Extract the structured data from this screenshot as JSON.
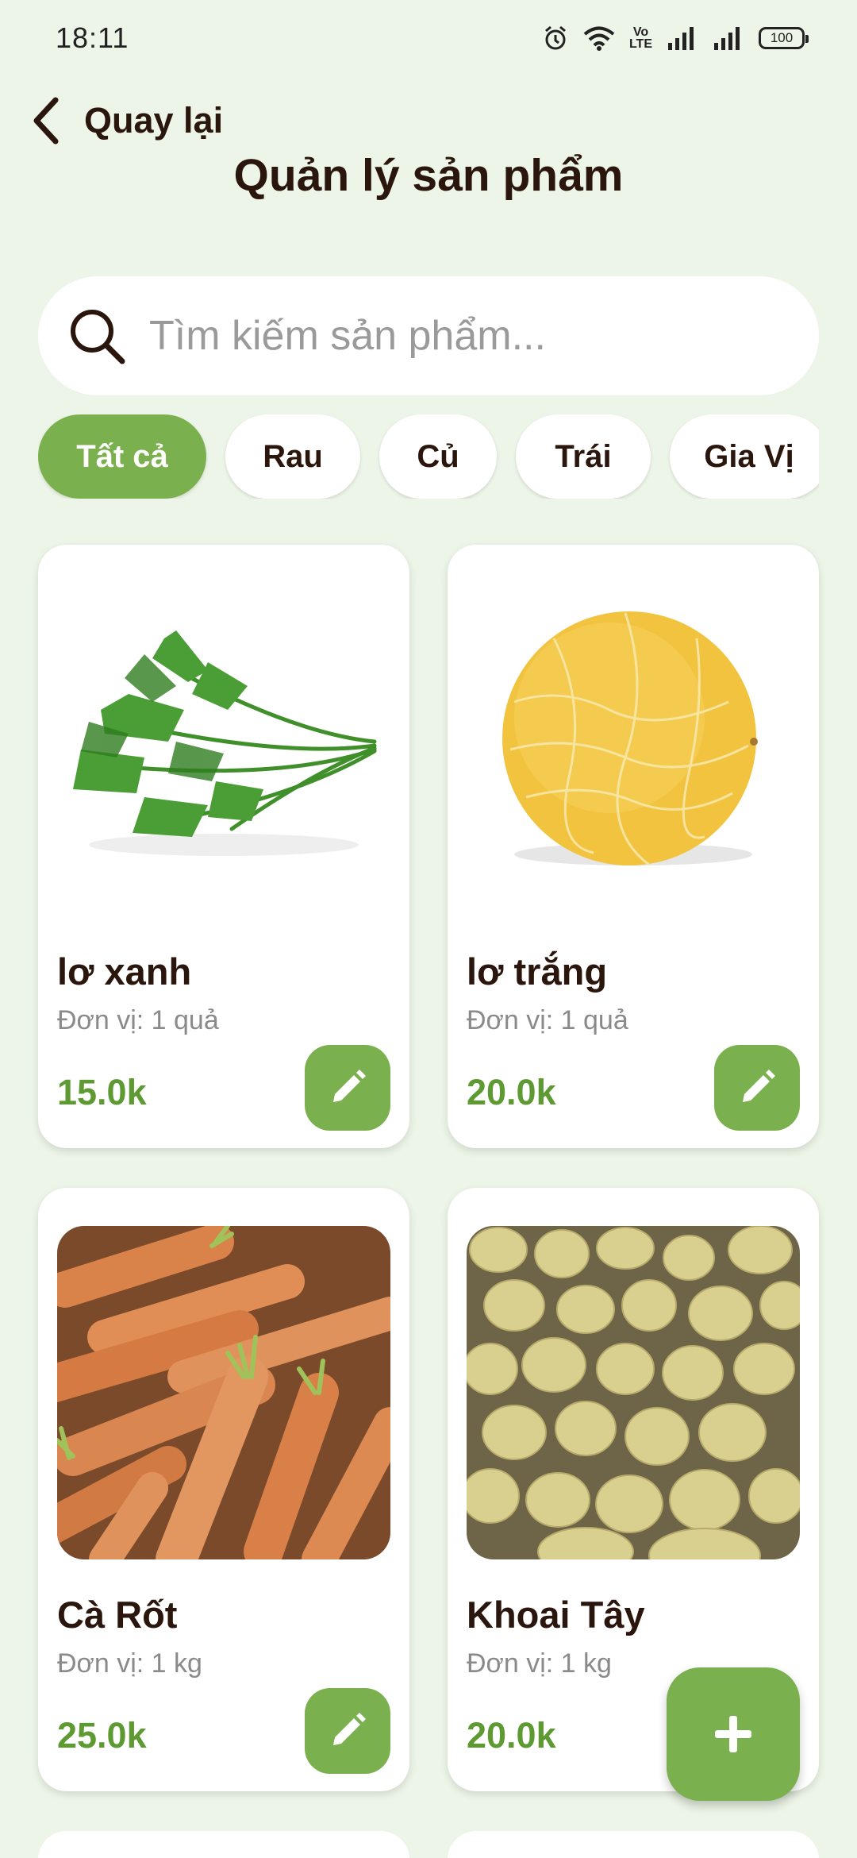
{
  "status_bar": {
    "time": "18:11",
    "volte_top": "Vo",
    "volte_bottom": "LTE",
    "battery": "100"
  },
  "header": {
    "back_label": "Quay lại",
    "title": "Quản lý sản phẩm"
  },
  "search": {
    "placeholder": "Tìm kiếm sản phẩm...",
    "value": ""
  },
  "categories": [
    {
      "label": "Tất cả",
      "active": true
    },
    {
      "label": "Rau",
      "active": false
    },
    {
      "label": "Củ",
      "active": false
    },
    {
      "label": "Trái",
      "active": false
    },
    {
      "label": "Gia Vị",
      "active": false
    }
  ],
  "products": [
    {
      "name": "lơ xanh",
      "unit": "Đơn vị: 1 quả",
      "price": "15.0k",
      "image": "mizuna-greens"
    },
    {
      "name": "lơ trắng",
      "unit": "Đơn vị: 1 quả",
      "price": "20.0k",
      "image": "yellow-melon"
    },
    {
      "name": "Cà Rốt",
      "unit": "Đơn vị: 1 kg",
      "price": "25.0k",
      "image": "carrots"
    },
    {
      "name": "Khoai Tây",
      "unit": "Đơn vị: 1 kg",
      "price": "20.0k",
      "image": "potatoes"
    }
  ],
  "colors": {
    "background": "#ecf5e7",
    "accent": "#7ab04e",
    "price": "#5e9a32",
    "title_text": "#2a160c"
  },
  "icons": {
    "back": "chevron-left-icon",
    "search": "search-icon",
    "edit": "pencil-icon",
    "add": "plus-icon"
  }
}
